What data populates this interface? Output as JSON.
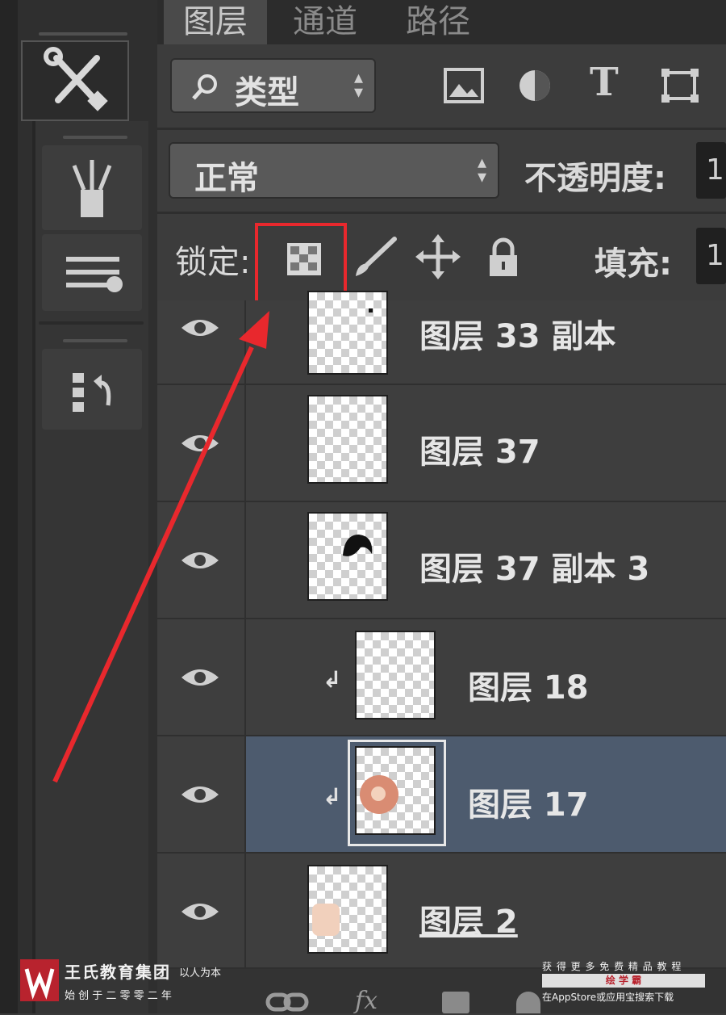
{
  "tabs": [
    "图层",
    "通道",
    "路径"
  ],
  "filter": {
    "kind_label": "类型",
    "icons": [
      "image-filter-icon",
      "adjustment-filter-icon",
      "type-filter-icon",
      "shape-filter-icon"
    ],
    "type_glyph": "T"
  },
  "blend": {
    "mode": "正常",
    "opacity_label": "不透明度:",
    "opacity_value": "1"
  },
  "lock": {
    "label": "锁定:",
    "fill_label": "填充:",
    "fill_value": "1"
  },
  "layers": [
    {
      "name": "图层 33 副本"
    },
    {
      "name": "图层 37"
    },
    {
      "name": "图层 37 副本 3"
    },
    {
      "name": "图层 18",
      "clipped": true
    },
    {
      "name": "图层 17",
      "clipped": true,
      "selected": true
    },
    {
      "name": "图层 2"
    }
  ],
  "clip_glyph": "↲",
  "watermark": {
    "org_name": "王氏教育集团",
    "motto": "以人为本",
    "founded": "始 创 于 二 零 零 二 年",
    "promo_line1": "获 得 更 多 免 费 精 品 教 程",
    "brand": "绘 学 霸",
    "promo_line2": "在AppStore或应用宝搜索下载"
  },
  "bottom_icons": [
    "link-icon",
    "fx-icon"
  ],
  "fx_label": "fx",
  "colors": {
    "highlight": "#e8282d",
    "selected_row": "#4d5b6e",
    "logo": "#b8232e"
  }
}
